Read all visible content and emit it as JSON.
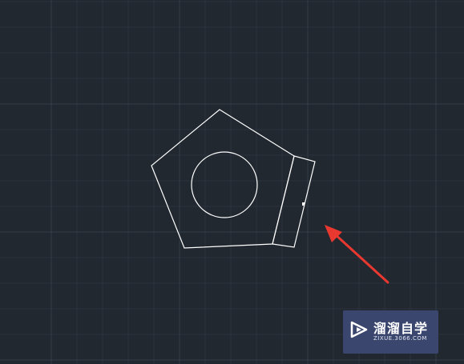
{
  "colors": {
    "background": "#212830",
    "grid_minor": "#2a323c",
    "grid_major": "#333d48",
    "geometry_stroke": "#ffffff",
    "arrow": "#e8382f",
    "watermark_bg": "#3a466e"
  },
  "watermark": {
    "title": "溜溜自学",
    "subtitle": "ZIXUE.3066.COM",
    "icon": "play-logo-icon"
  },
  "drawing": {
    "entities": [
      "pentagon",
      "circle",
      "rectangle",
      "grip-point"
    ],
    "annotation_icon": "red-arrow-icon"
  }
}
